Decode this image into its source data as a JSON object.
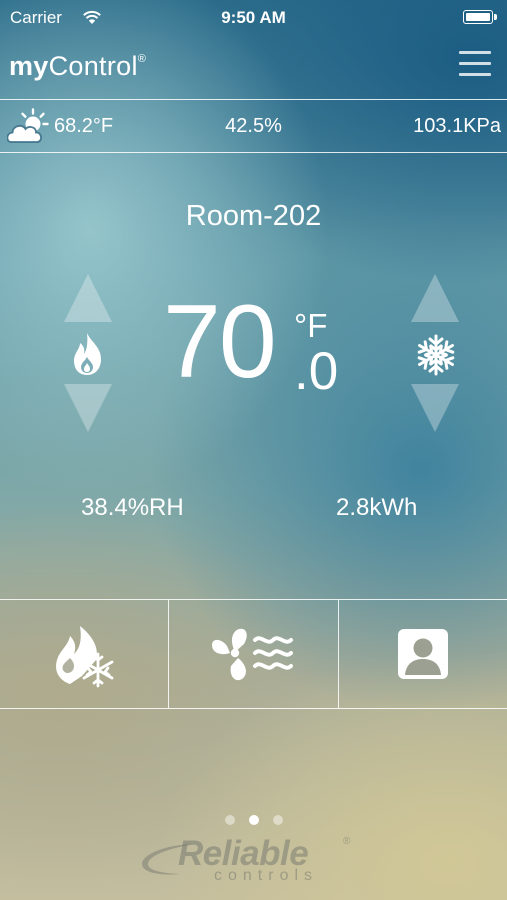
{
  "status_bar": {
    "carrier": "Carrier",
    "time": "9:50 AM"
  },
  "header": {
    "logo_text_1": "my",
    "logo_text_2": "Control",
    "logo_mark": "®",
    "menu_icon": "hamburger-menu-icon"
  },
  "weather": {
    "icon": "partly-cloudy-icon",
    "outdoor_temp": "68.2°F",
    "outdoor_humidity": "42.5%",
    "pressure": "103.1KPa"
  },
  "room": {
    "name": "Room-202",
    "setpoint_whole": "70",
    "setpoint_unit": "°F",
    "setpoint_decimal": ".0",
    "humidity": "38.4%RH",
    "energy": "2.8kWh"
  },
  "controls": {
    "heat_icon": "flame-icon",
    "cool_icon": "snowflake-icon",
    "heat_up": "triangle-up-icon",
    "heat_down": "triangle-down-icon",
    "cool_up": "triangle-up-icon",
    "cool_down": "triangle-down-icon"
  },
  "modes": [
    {
      "icon": "heat-cool-mode-icon"
    },
    {
      "icon": "fan-icon"
    },
    {
      "icon": "occupancy-person-icon"
    }
  ],
  "pagination": {
    "count": 3,
    "active_index": 1
  },
  "brand": {
    "name": "Reliable",
    "sub": "controls",
    "mark": "®"
  },
  "colors": {
    "text": "#ffffff",
    "divider": "#ffffff"
  }
}
